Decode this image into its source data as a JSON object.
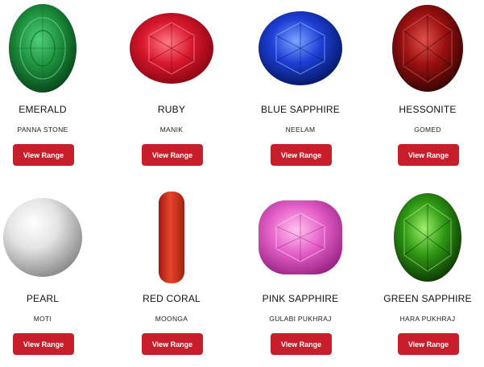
{
  "gems": [
    {
      "name": "EMERALD",
      "alias": "PANNA STONE",
      "button": "View Range",
      "icon": "emerald-gem-icon"
    },
    {
      "name": "RUBY",
      "alias": "MANIK",
      "button": "View Range",
      "icon": "ruby-gem-icon"
    },
    {
      "name": "BLUE SAPPHIRE",
      "alias": "NEELAM",
      "button": "View Range",
      "icon": "blue-sapphire-gem-icon"
    },
    {
      "name": "HESSONITE",
      "alias": "GOMED",
      "button": "View Range",
      "icon": "hessonite-gem-icon"
    },
    {
      "name": "PEARL",
      "alias": "MOTI",
      "button": "View Range",
      "icon": "pearl-gem-icon"
    },
    {
      "name": "RED CORAL",
      "alias": "MOONGA",
      "button": "View Range",
      "icon": "red-coral-gem-icon"
    },
    {
      "name": "PINK SAPPHIRE",
      "alias": "GULABI PUKHRAJ",
      "button": "View Range",
      "icon": "pink-sapphire-gem-icon"
    },
    {
      "name": "GREEN SAPPHIRE",
      "alias": "HARA PUKHRAJ",
      "button": "View Range",
      "icon": "green-sapphire-gem-icon"
    }
  ],
  "colors": {
    "button_bg": "#c81d2a",
    "button_text": "#ffffff",
    "emerald": "#1c8a3a",
    "ruby": "#d8172c",
    "blue_sapphire": "#1d3fd6",
    "hessonite": "#9a1010",
    "pearl": "#e8e8e8",
    "red_coral": "#d9321e",
    "pink_sapphire": "#e55fc8",
    "green_sapphire": "#2f9a14"
  }
}
